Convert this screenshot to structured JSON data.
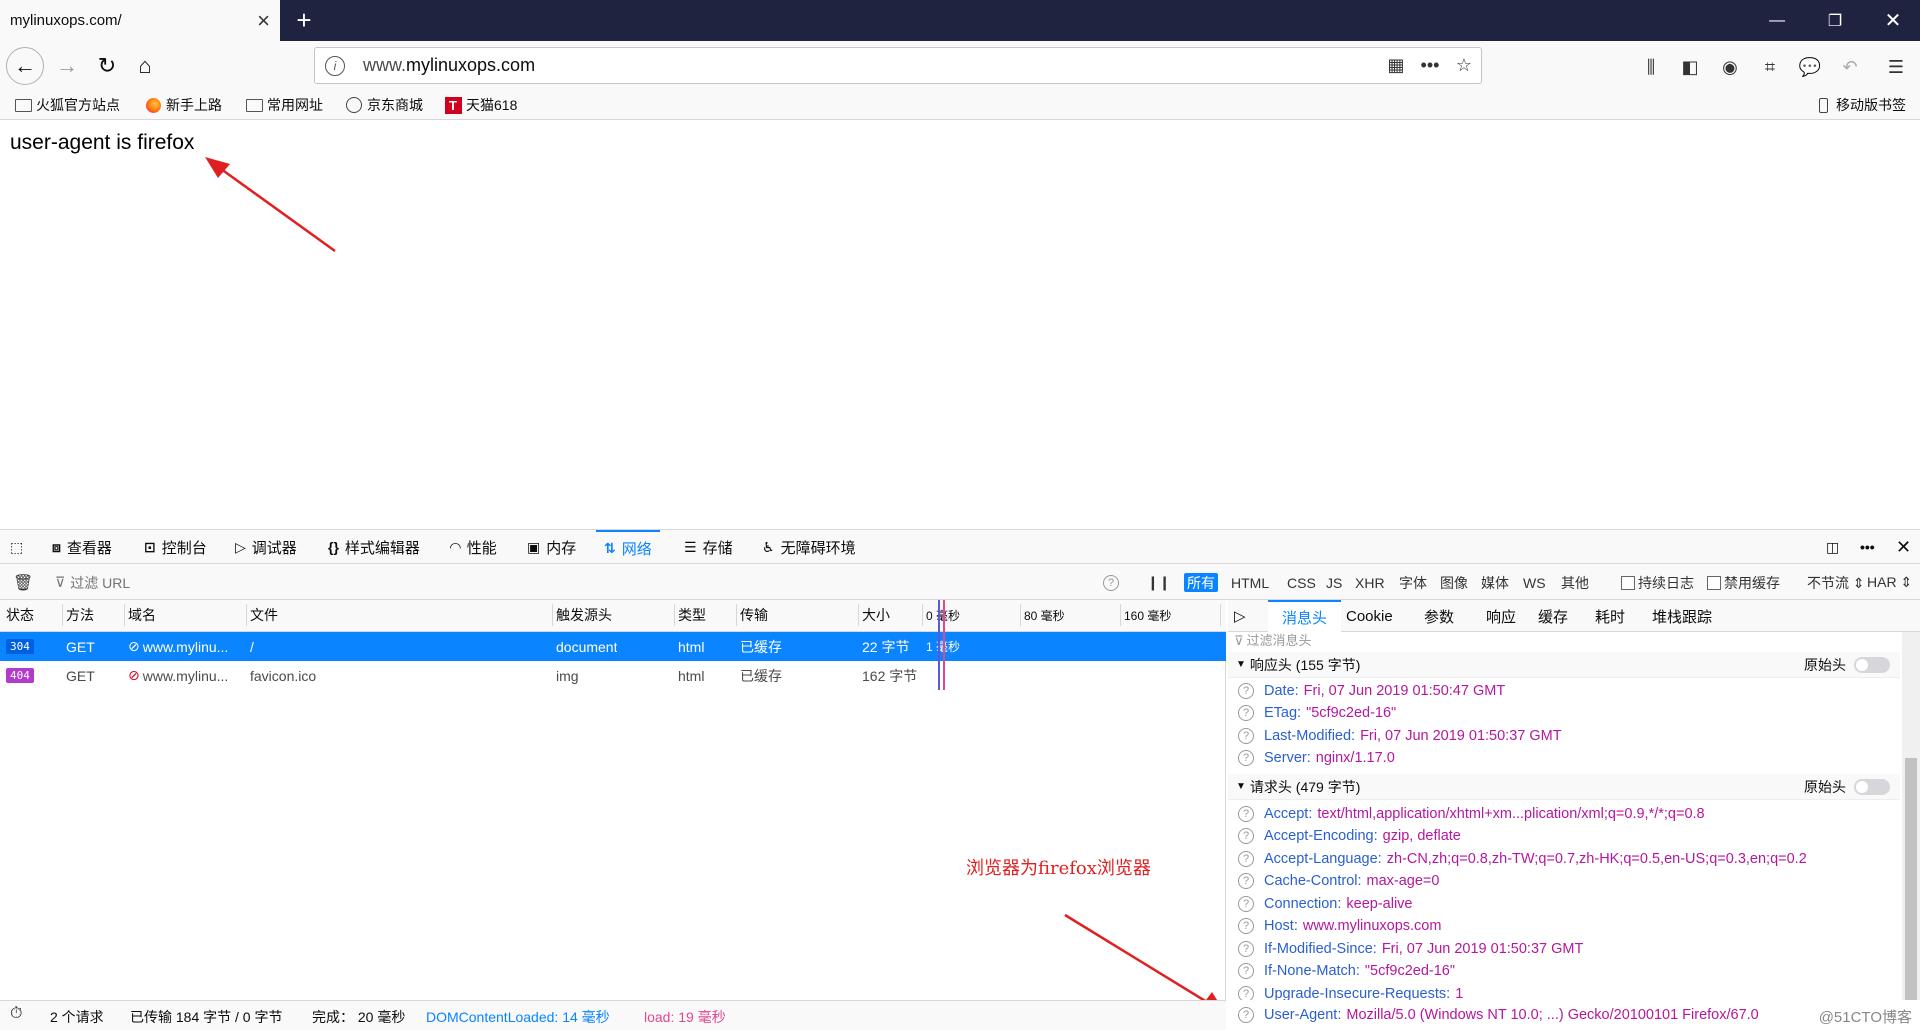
{
  "browser": {
    "tab_title": "mylinuxops.com/",
    "new_tab": "+",
    "url_prefix": "www.",
    "url_host": "mylinuxops.com",
    "more_actions": "•••"
  },
  "bookmarks": [
    {
      "label": "火狐官方站点",
      "icon": "folder-icon"
    },
    {
      "label": "新手上路",
      "icon": "firefox-icon"
    },
    {
      "label": "常用网址",
      "icon": "folder-icon"
    },
    {
      "label": "京东商城",
      "icon": "globe-icon"
    },
    {
      "label": "天猫618",
      "icon": "tmall-icon"
    }
  ],
  "mobile_bookmarks": "移动版书签",
  "page": {
    "text": "user-agent is firefox"
  },
  "devtools": {
    "tabs": [
      "查看器",
      "控制台",
      "调试器",
      "样式编辑器",
      "性能",
      "内存",
      "网络",
      "存储",
      "无障碍环境"
    ],
    "selected_tab": "网络",
    "filter_placeholder": "过滤 URL",
    "type_filters": [
      "所有",
      "HTML",
      "CSS",
      "JS",
      "XHR",
      "字体",
      "图像",
      "媒体",
      "WS",
      "其他"
    ],
    "persist_log": "持续日志",
    "disable_cache": "禁用缓存",
    "throttling": "不节流 ⇕",
    "har": "HAR ⇕",
    "columns": [
      "状态",
      "方法",
      "域名",
      "文件",
      "触发源头",
      "类型",
      "传输",
      "大小"
    ],
    "timeline_ticks": [
      "0 毫秒",
      "80 毫秒",
      "160 毫秒"
    ],
    "requests": [
      {
        "status": "304",
        "method": "GET",
        "domain": "www.mylinu...",
        "file": "/",
        "cause": "document",
        "type": "html",
        "transfer": "已缓存",
        "size": "22 字节",
        "time": "1 毫秒"
      },
      {
        "status": "404",
        "method": "GET",
        "domain": "www.mylinu...",
        "file": "favicon.ico",
        "cause": "img",
        "type": "html",
        "transfer": "已缓存",
        "size": "162 字节",
        "time": ""
      }
    ],
    "status_colors": {
      "304": "#0a84ff",
      "404": "#b33bcc"
    },
    "statusbar": {
      "requests": "2 个请求",
      "transferred": "已传输 184 字节 / 0 字节",
      "finish": "完成： 20 毫秒",
      "dom_loaded": "DOMContentLoaded: 14 毫秒",
      "load": "load: 19 毫秒"
    },
    "details": {
      "tabs": [
        "消息头",
        "Cookie",
        "参数",
        "响应",
        "缓存",
        "耗时",
        "堆栈跟踪"
      ],
      "selected_tab": "消息头",
      "filter_placeholder": "过滤消息头",
      "raw_label": "原始头",
      "response_section": "响应头 (155 字节)",
      "response_headers": [
        {
          "name": "Date:",
          "value": "Fri, 07 Jun 2019 01:50:47 GMT"
        },
        {
          "name": "ETag:",
          "value": "\"5cf9c2ed-16\""
        },
        {
          "name": "Last-Modified:",
          "value": "Fri, 07 Jun 2019 01:50:37 GMT"
        },
        {
          "name": "Server:",
          "value": "nginx/1.17.0"
        }
      ],
      "request_section": "请求头 (479 字节)",
      "request_headers": [
        {
          "name": "Accept:",
          "value": "text/html,application/xhtml+xm...plication/xml;q=0.9,*/*;q=0.8"
        },
        {
          "name": "Accept-Encoding:",
          "value": "gzip, deflate"
        },
        {
          "name": "Accept-Language:",
          "value": "zh-CN,zh;q=0.8,zh-TW;q=0.7,zh-HK;q=0.5,en-US;q=0.3,en;q=0.2"
        },
        {
          "name": "Cache-Control:",
          "value": "max-age=0"
        },
        {
          "name": "Connection:",
          "value": "keep-alive"
        },
        {
          "name": "Host:",
          "value": "www.mylinuxops.com"
        },
        {
          "name": "If-Modified-Since:",
          "value": "Fri, 07 Jun 2019 01:50:37 GMT"
        },
        {
          "name": "If-None-Match:",
          "value": "\"5cf9c2ed-16\""
        },
        {
          "name": "Upgrade-Insecure-Requests:",
          "value": "1"
        },
        {
          "name": "User-Agent:",
          "value": "Mozilla/5.0 (Windows NT 10.0; ...) Gecko/20100101 Firefox/67.0"
        }
      ]
    }
  },
  "annotation": {
    "note": "浏览器为firefox浏览器",
    "color": "#e02020"
  },
  "watermark": "@51CTO博客"
}
